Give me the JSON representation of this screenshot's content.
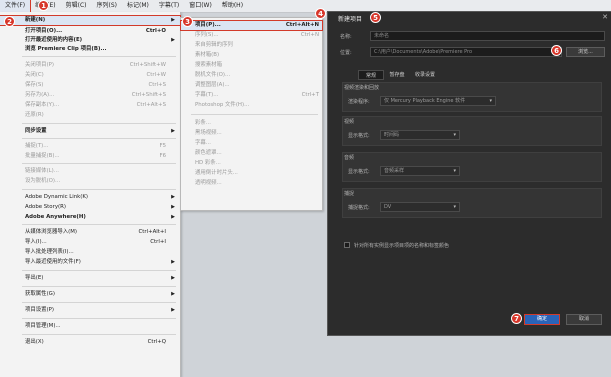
{
  "menubar": {
    "items": [
      "文件(F)",
      "编辑(E)",
      "剪辑(C)",
      "序列(S)",
      "标记(M)",
      "字幕(T)",
      "窗口(W)",
      "帮助(H)"
    ]
  },
  "file_menu": {
    "items": [
      {
        "label": "新建(N)",
        "shortcut": "",
        "arrow": true
      },
      {
        "label": "打开项目(O)...",
        "shortcut": "Ctrl+O"
      },
      {
        "label": "打开最近使用的内容(E)",
        "shortcut": "",
        "arrow": true
      },
      {
        "label": "浏览 Premiere Clip 项目(B)...",
        "shortcut": ""
      },
      {
        "label": "关闭项目(P)",
        "shortcut": "Ctrl+Shift+W"
      },
      {
        "label": "关闭(C)",
        "shortcut": "Ctrl+W"
      },
      {
        "label": "保存(S)",
        "shortcut": "Ctrl+S"
      },
      {
        "label": "另存为(A)...",
        "shortcut": "Ctrl+Shift+S"
      },
      {
        "label": "保存副本(Y)...",
        "shortcut": "Ctrl+Alt+S"
      },
      {
        "label": "还原(R)",
        "shortcut": ""
      },
      {
        "label": "同步设置",
        "shortcut": "",
        "arrow": true
      },
      {
        "label": "捕捉(T)...",
        "shortcut": "F5"
      },
      {
        "label": "批量捕捉(B)...",
        "shortcut": "F6"
      },
      {
        "label": "链接媒体(L)...",
        "shortcut": ""
      },
      {
        "label": "设为脱机(O)...",
        "shortcut": ""
      },
      {
        "label": "Adobe Dynamic Link(K)",
        "shortcut": "",
        "arrow": true
      },
      {
        "label": "Adobe Story(R)",
        "shortcut": "",
        "arrow": true
      },
      {
        "label": "Adobe Anywhere(H)",
        "shortcut": "",
        "arrow": true
      },
      {
        "label": "从媒体浏览器导入(M)",
        "shortcut": "Ctrl+Alt+I"
      },
      {
        "label": "导入(I)...",
        "shortcut": "Ctrl+I"
      },
      {
        "label": "导入批处理列表(I)...",
        "shortcut": ""
      },
      {
        "label": "导入最近使用的文件(F)",
        "shortcut": "",
        "arrow": true
      },
      {
        "label": "导出(E)",
        "shortcut": "",
        "arrow": true
      },
      {
        "label": "获取属性(G)",
        "shortcut": "",
        "arrow": true
      },
      {
        "label": "项目设置(P)",
        "shortcut": "",
        "arrow": true
      },
      {
        "label": "项目管理(M)...",
        "shortcut": ""
      },
      {
        "label": "退出(X)",
        "shortcut": "Ctrl+Q"
      }
    ]
  },
  "new_submenu": {
    "items": [
      {
        "label": "项目(P)...",
        "shortcut": "Ctrl+Alt+N"
      },
      {
        "label": "序列(S)...",
        "shortcut": "Ctrl+N"
      },
      {
        "label": "来自剪辑的序列",
        "shortcut": ""
      },
      {
        "label": "素材箱(B)",
        "shortcut": ""
      },
      {
        "label": "搜索素材箱",
        "shortcut": ""
      },
      {
        "label": "脱机文件(O)...",
        "shortcut": ""
      },
      {
        "label": "调整图层(A)...",
        "shortcut": ""
      },
      {
        "label": "字幕(T)...",
        "shortcut": "Ctrl+T"
      },
      {
        "label": "Photoshop 文件(H)...",
        "shortcut": ""
      },
      {
        "label": "彩条...",
        "shortcut": ""
      },
      {
        "label": "黑场视频...",
        "shortcut": ""
      },
      {
        "label": "字幕...",
        "shortcut": ""
      },
      {
        "label": "颜色遮罩...",
        "shortcut": ""
      },
      {
        "label": "HD 彩条...",
        "shortcut": ""
      },
      {
        "label": "通用倒计时片头...",
        "shortcut": ""
      },
      {
        "label": "透明视频...",
        "shortcut": ""
      }
    ]
  },
  "dialog": {
    "title": "新建项目",
    "name_label": "名称:",
    "name_value": "未命名",
    "location_label": "位置:",
    "location_value": "C:\\用户\\Documents\\Adobe\\Premiere Pro",
    "browse_label": "浏览...",
    "tabs": [
      "常规",
      "暂存盘",
      "收录设置"
    ],
    "renderer_section_label": "视频渲染和回放",
    "renderer_label": "渲染程序:",
    "renderer_value": "仅 Mercury Playback Engine 软件",
    "video_section_label": "视频",
    "video_label": "显示格式:",
    "video_value": "时间码",
    "audio_section_label": "音频",
    "audio_label": "显示格式:",
    "audio_value": "音频采样",
    "capture_section_label": "捕捉",
    "capture_label": "捕捉格式:",
    "capture_value": "DV",
    "checkbox_label": "针对所有实例显示项目项的名称和标签颜色",
    "ok_label": "确定",
    "cancel_label": "取消"
  },
  "callouts": [
    "1",
    "2",
    "3",
    "4",
    "5",
    "6",
    "7"
  ],
  "colors": {
    "callout": "#d7362a",
    "highlight_border": "#d23a2a",
    "dialog_bg": "#2c2c2c",
    "primary_button": "#2a63b8"
  }
}
